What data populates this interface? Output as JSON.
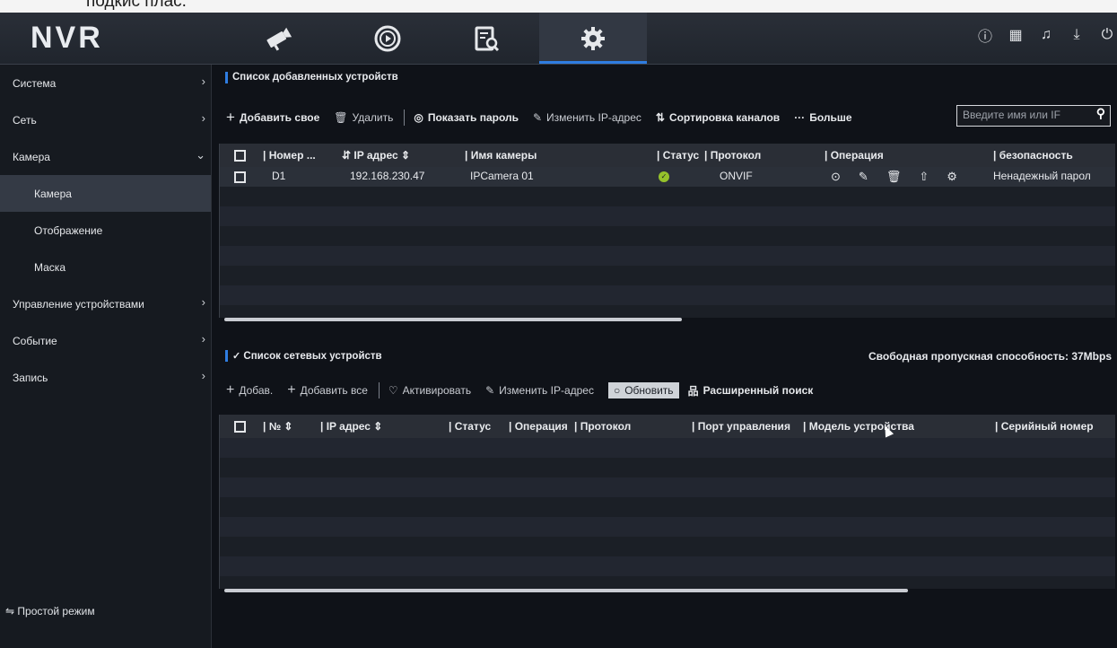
{
  "overlay_text": "подкис плас.",
  "app": {
    "logo": "NVR"
  },
  "nav": {
    "tabs": [
      {
        "icon": "camera-icon",
        "active": false
      },
      {
        "icon": "playback-icon",
        "active": false
      },
      {
        "icon": "search-document-icon",
        "active": false
      },
      {
        "icon": "settings-gear-icon",
        "active": true
      }
    ],
    "right_icons": [
      "info-icon",
      "grid-icon",
      "bell-icon",
      "download-icon",
      "power-icon"
    ]
  },
  "sidebar": {
    "items": [
      {
        "label": "Система",
        "arrow": "›"
      },
      {
        "label": "Сеть",
        "arrow": "›"
      },
      {
        "label": "Камера",
        "arrow": "⌄"
      },
      {
        "label": "Камера",
        "sub": true,
        "selected": true
      },
      {
        "label": "Отображение",
        "sub": true
      },
      {
        "label": "Маска",
        "sub": true
      },
      {
        "label": "Управление устройствами",
        "arrow": "›"
      },
      {
        "label": "Событие",
        "arrow": "›"
      },
      {
        "label": "Запись",
        "arrow": "›"
      }
    ],
    "simple_mode": "⇋ Простой режим"
  },
  "added": {
    "title": "Список добавленных устройств",
    "toolbar": {
      "add_own": "Добавить свое",
      "delete": "Удалить",
      "show_password": "Показать пароль",
      "change_ip": "Изменить IP-адрес",
      "sort_channels": "Сортировка каналов",
      "more": "Больше"
    },
    "search_placeholder": "Введите имя или IF",
    "columns": {
      "number": "| Номер ...",
      "ip": "⇵ IP адрес ⇕",
      "name": "| Имя камеры",
      "status": "| Статус",
      "protocol": "| Протокол",
      "operation": "| Операция",
      "security": "| безопасность"
    },
    "rows": [
      {
        "number": "D1",
        "ip": "192.168.230.47",
        "name": "IPCamera 01",
        "status": "ok",
        "protocol": "ONVIF",
        "security": "Ненадежный парол"
      }
    ]
  },
  "network": {
    "title": "Список сетевых устройств",
    "free_bandwidth": "Свободная пропускная способность: 37Mbps",
    "toolbar": {
      "add": "Добав.",
      "add_all": "Добавить все",
      "activate": "Активировать",
      "change_ip": "Изменить IP-адрес",
      "refresh": "Обновить",
      "advanced_search": "Расширенный поиск"
    },
    "columns": {
      "number": "| № ⇕",
      "ip": "| IP адрес ⇕",
      "status": "| Статус",
      "operation": "| Операция",
      "protocol": "| Протокол",
      "port": "| Порт управления",
      "model": "| Модель устройства",
      "serial": "| Серийный номер"
    }
  },
  "colors": {
    "accent": "#2f7de1",
    "status_ok": "#95c22b",
    "bg": "#0f1218"
  }
}
